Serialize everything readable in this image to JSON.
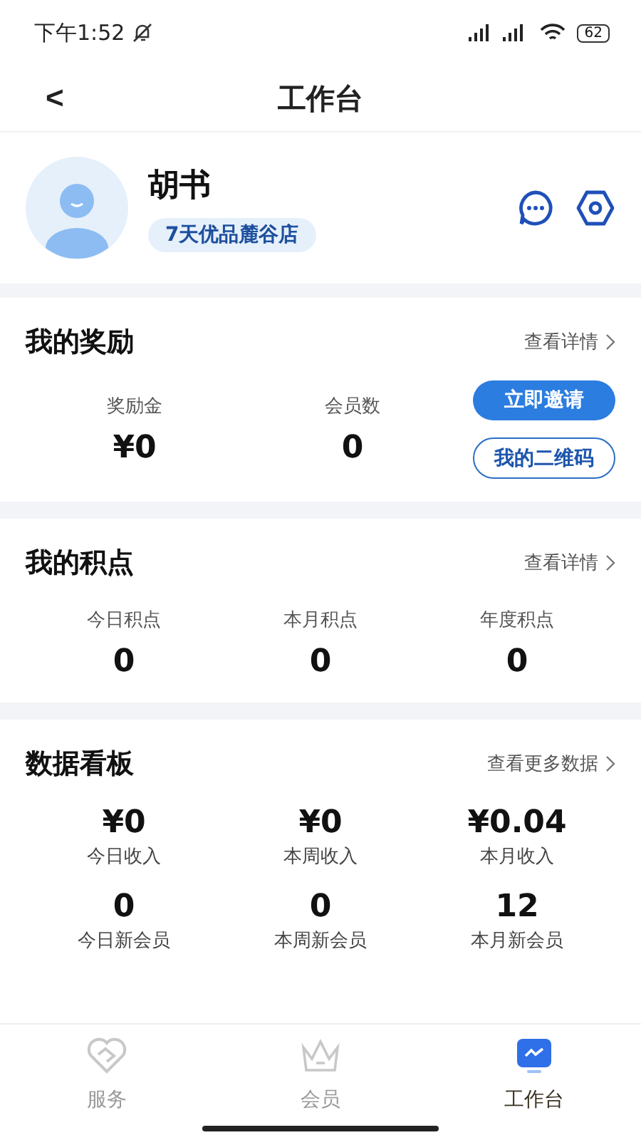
{
  "status_bar": {
    "time": "下午1:52",
    "battery": "62"
  },
  "nav": {
    "back": "<",
    "title": "工作台"
  },
  "profile": {
    "name": "胡书",
    "store": "7天优品麓谷店"
  },
  "rewards": {
    "title": "我的奖励",
    "link": "查看详情",
    "stats": [
      {
        "label": "奖励金",
        "value": "¥0"
      },
      {
        "label": "会员数",
        "value": "0"
      }
    ],
    "invite_button": "立即邀请",
    "qr_button": "我的二维码"
  },
  "points": {
    "title": "我的积点",
    "link": "查看详情",
    "stats": [
      {
        "label": "今日积点",
        "value": "0"
      },
      {
        "label": "本月积点",
        "value": "0"
      },
      {
        "label": "年度积点",
        "value": "0"
      }
    ]
  },
  "dashboard": {
    "title": "数据看板",
    "link": "查看更多数据",
    "stats": [
      {
        "value": "¥0",
        "label": "今日收入"
      },
      {
        "value": "¥0",
        "label": "本周收入"
      },
      {
        "value": "¥0.04",
        "label": "本月收入"
      },
      {
        "value": "0",
        "label": "今日新会员"
      },
      {
        "value": "0",
        "label": "本周新会员"
      },
      {
        "value": "12",
        "label": "本月新会员"
      }
    ]
  },
  "tabs": [
    {
      "label": "服务",
      "kind": "heart",
      "selected": false
    },
    {
      "label": "会员",
      "kind": "crown",
      "selected": false
    },
    {
      "label": "工作台",
      "kind": "chart",
      "selected": true
    }
  ]
}
